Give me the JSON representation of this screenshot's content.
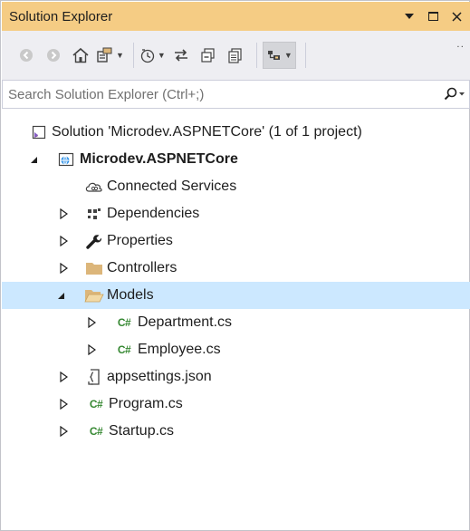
{
  "window": {
    "title": "Solution Explorer",
    "controls": [
      "pin-dropdown",
      "maximize",
      "close"
    ]
  },
  "toolbar": {
    "buttons": [
      "back",
      "forward",
      "home",
      "switch-views",
      "pending-changes-filter",
      "sync-with-active-document",
      "collapse-all",
      "show-all-files",
      "preview-selected-items"
    ]
  },
  "search": {
    "placeholder": "Search Solution Explorer (Ctrl+;)"
  },
  "tree": {
    "solution": "Solution 'Microdev.ASPNETCore' (1 of 1 project)",
    "project": "Microdev.ASPNETCore",
    "connected_services": "Connected Services",
    "dependencies": "Dependencies",
    "properties": "Properties",
    "controllers": "Controllers",
    "models": "Models",
    "department": "Department.cs",
    "employee": "Employee.cs",
    "appsettings": "appsettings.json",
    "program": "Program.cs",
    "startup": "Startup.cs",
    "cs_badge": "C#",
    "selected_item": "Models"
  },
  "colors": {
    "titlebar": "#f5cc84",
    "toolbar": "#eeeef2",
    "selection": "#cce8ff",
    "folder": "#dcb67a",
    "csharp": "#368832"
  }
}
